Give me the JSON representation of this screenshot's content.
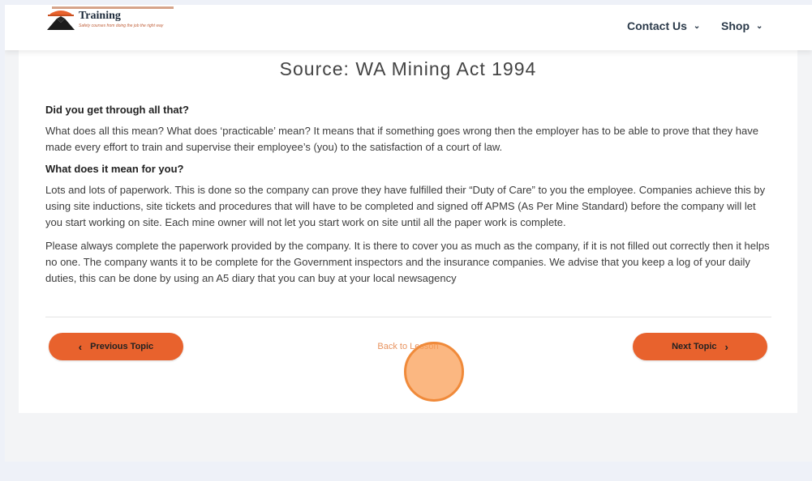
{
  "header": {
    "logo_title": "Training",
    "logo_tagline": "Safety courses from doing the job the right way",
    "nav": [
      {
        "label": "Contact Us",
        "icon": "chevron-down-icon"
      },
      {
        "label": "Shop",
        "icon": "chevron-down-icon"
      }
    ]
  },
  "content": {
    "source_line": "Source: WA Mining Act 1994",
    "heading1": "Did you get through all that?",
    "para1": "What does all this mean? What does ‘practicable’ mean? It means that if something goes wrong then the employer has to be able to prove that they have made every effort to train and supervise their employee’s (you) to the satisfaction of a court of law.",
    "heading2": "What does it mean for you?",
    "para2": "Lots and lots of paperwork. This is done so the company can prove they have fulfilled their “Duty of Care” to you the employee. Companies achieve this by using site inductions, site tickets and procedures that will have to be completed and signed off APMS (As Per Mine Standard) before the company will let you start working on site. Each mine owner will not let you start work on site until all the paper work is complete.",
    "para3": "Please always complete the paperwork provided by the company. It is there to cover you as much as the company, if it is not filled out correctly then it helps no one. The company wants it to be complete for the Government inspectors and the insurance companies. We advise that you keep a log of your daily duties, this can be done by using an A5 diary that you can buy at your local newsagency"
  },
  "navigation": {
    "prev_label": "Previous Topic",
    "back_label": "Back to Lesson",
    "next_label": "Next Topic"
  },
  "colors": {
    "accent": "#e8622d",
    "click_highlight": "#f08a3a"
  }
}
